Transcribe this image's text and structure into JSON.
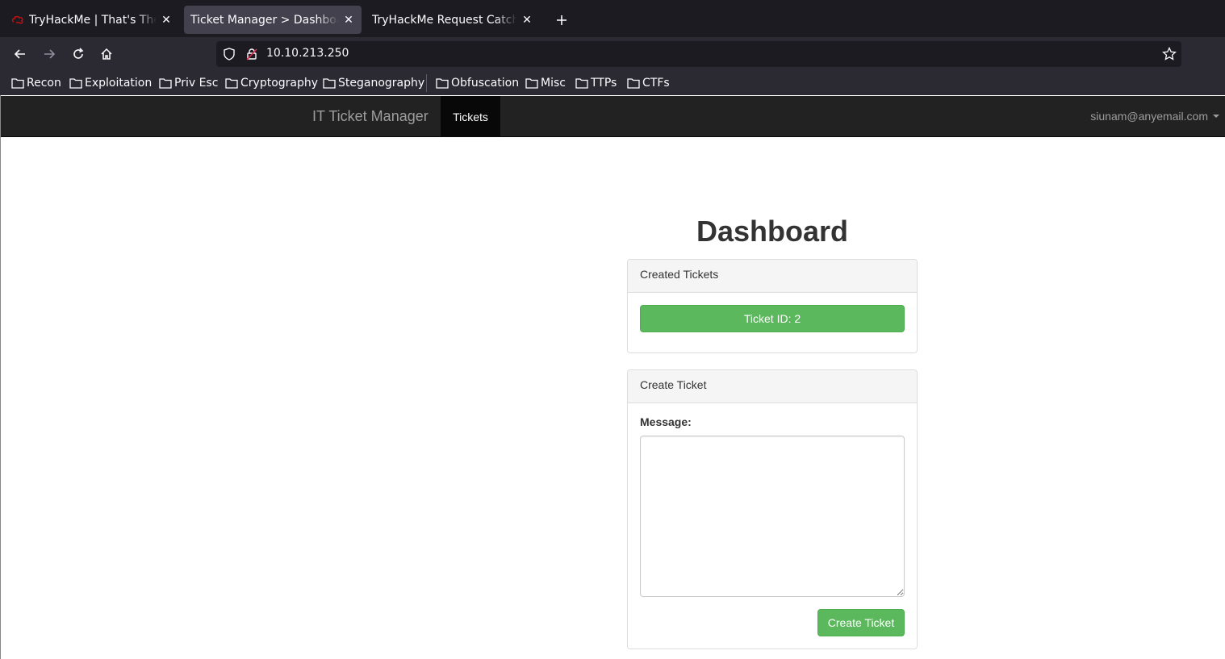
{
  "browser": {
    "tabs": [
      {
        "title": "TryHackMe | That's The Ti",
        "active": false
      },
      {
        "title": "Ticket Manager > Dashboard",
        "active": true
      },
      {
        "title": "TryHackMe Request Catcher",
        "active": false
      }
    ],
    "url": "10.10.213.250",
    "bookmarks": [
      "Recon",
      "Exploitation",
      "Priv Esc",
      "Cryptography",
      "Steganography",
      "Obfuscation",
      "Misc",
      "TTPs",
      "CTFs"
    ]
  },
  "site": {
    "brand": "IT Ticket Manager",
    "nav_active": "Tickets",
    "user_email": "siunam@anyemail.com"
  },
  "dashboard": {
    "title": "Dashboard",
    "created_panel": {
      "heading": "Created Tickets",
      "tickets": [
        "Ticket ID: 2"
      ]
    },
    "create_panel": {
      "heading": "Create Ticket",
      "message_label": "Message:",
      "message_value": "",
      "submit_label": "Create Ticket"
    }
  },
  "colors": {
    "success": "#5cb85c",
    "navbar": "#222222",
    "chrome_dark": "#1c1b22",
    "chrome": "#2b2a33"
  }
}
